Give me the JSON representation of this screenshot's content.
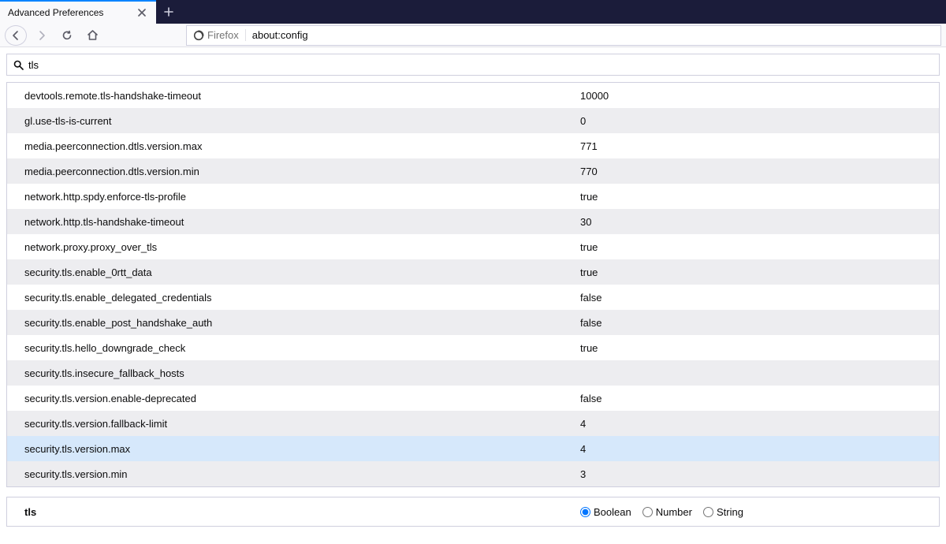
{
  "tab": {
    "title": "Advanced Preferences"
  },
  "urlbar": {
    "identity": "Firefox",
    "url": "about:config"
  },
  "search": {
    "value": "tls"
  },
  "prefs": [
    {
      "name": "devtools.remote.tls-handshake-timeout",
      "value": "10000"
    },
    {
      "name": "gl.use-tls-is-current",
      "value": "0"
    },
    {
      "name": "media.peerconnection.dtls.version.max",
      "value": "771"
    },
    {
      "name": "media.peerconnection.dtls.version.min",
      "value": "770"
    },
    {
      "name": "network.http.spdy.enforce-tls-profile",
      "value": "true"
    },
    {
      "name": "network.http.tls-handshake-timeout",
      "value": "30"
    },
    {
      "name": "network.proxy.proxy_over_tls",
      "value": "true"
    },
    {
      "name": "security.tls.enable_0rtt_data",
      "value": "true"
    },
    {
      "name": "security.tls.enable_delegated_credentials",
      "value": "false"
    },
    {
      "name": "security.tls.enable_post_handshake_auth",
      "value": "false"
    },
    {
      "name": "security.tls.hello_downgrade_check",
      "value": "true"
    },
    {
      "name": "security.tls.insecure_fallback_hosts",
      "value": ""
    },
    {
      "name": "security.tls.version.enable-deprecated",
      "value": "false"
    },
    {
      "name": "security.tls.version.fallback-limit",
      "value": "4"
    },
    {
      "name": "security.tls.version.max",
      "value": "4",
      "selected": true
    },
    {
      "name": "security.tls.version.min",
      "value": "3"
    }
  ],
  "add": {
    "name": "tls",
    "types": {
      "boolean": "Boolean",
      "number": "Number",
      "string": "String"
    },
    "selected": "boolean"
  }
}
